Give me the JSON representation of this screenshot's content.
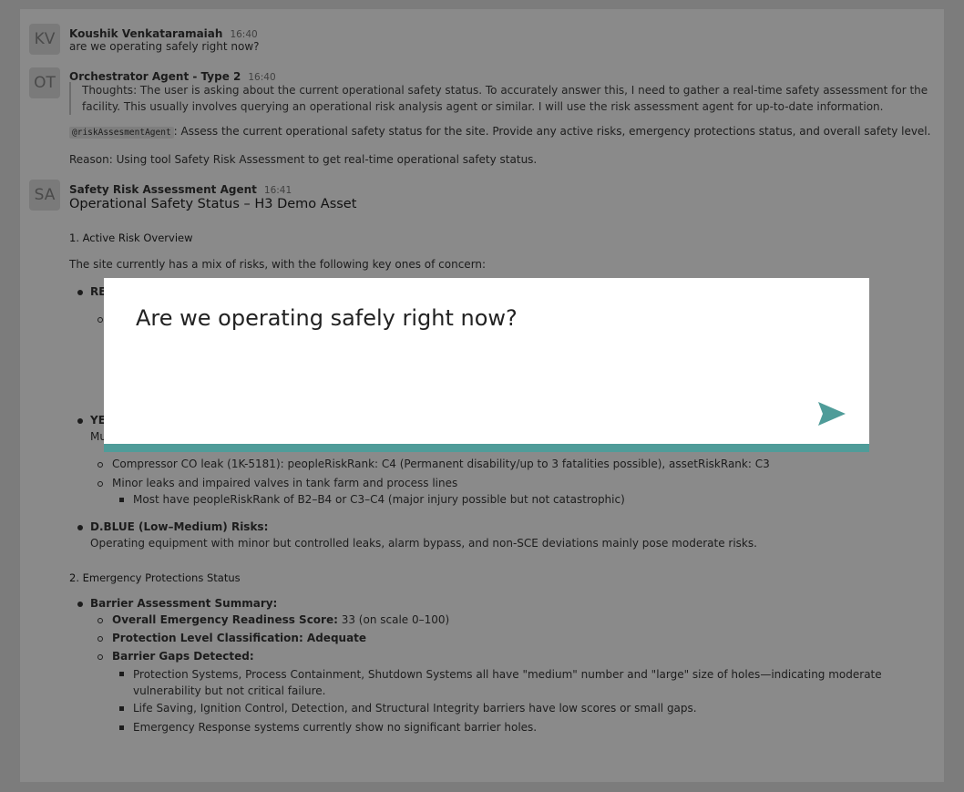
{
  "messages": {
    "user": {
      "avatar": "KV",
      "name": "Koushik Venkataramaiah",
      "time": "16:40",
      "text": "are we operating safely right now?"
    },
    "orchestrator": {
      "avatar": "OT",
      "name": "Orchestrator Agent - Type 2",
      "time": "16:40",
      "thoughts": "Thoughts: The user is asking about the current operational safety status. To accurately answer this, I need to gather a real-time safety assessment for the facility. This usually involves querying an operational risk analysis agent or similar. I will use the risk assessment agent for up-to-date information.",
      "mention": "@riskAssesmentAgent",
      "instruction": ": Assess the current operational safety status for the site. Provide any active risks, emergency protections status, and overall safety level.",
      "reason": "Reason: Using tool Safety Risk Assessment to get real-time operational safety status."
    },
    "safety": {
      "avatar": "SA",
      "name": "Safety Risk Assessment Agent",
      "time": "16:41",
      "heading": "Operational Safety Status – H3 Demo Asset",
      "section1": "1. Active Risk Overview",
      "intro": "The site currently has a mix of risks, with the following key ones of concern:",
      "red_fragment": "RE",
      "yellow_fragment": "YE",
      "yellow_sub_fragment": "Mu",
      "compressor": "Compressor CO leak (1K-5181): peopleRiskRank: C4 (Permanent disability/up to 3 fatalities possible), assetRiskRank: C3",
      "minor_leaks": "Minor leaks and impaired valves in tank farm and process lines",
      "most_have": "Most have peopleRiskRank of B2–B4 or C3–C4 (major injury possible but not catastrophic)",
      "dblue_title": "D.BLUE (Low–Medium) Risks:",
      "dblue_text": "Operating equipment with minor but controlled leaks, alarm bypass, and non-SCE deviations mainly pose moderate risks.",
      "section2": "2. Emergency Protections Status",
      "barrier_summary": "Barrier Assessment Summary:",
      "readiness_label": "Overall Emergency Readiness Score:",
      "readiness_value": " 33 (on scale 0–100)",
      "protection_level": "Protection Level Classification: Adequate",
      "gaps_title": "Barrier Gaps Detected:",
      "gap1": "Protection Systems, Process Containment, Shutdown Systems all have \"medium\" number and \"large\" size of holes—indicating moderate vulnerability but not critical failure.",
      "gap2": "Life Saving, Ignition Control, Detection, and Structural Integrity barriers have low scores or small gaps.",
      "gap3": "Emergency Response systems currently show no significant barrier holes."
    }
  },
  "modal": {
    "query": "Are we operating safely right now?",
    "accent": "#4f9c99",
    "send_icon": "send-icon"
  }
}
